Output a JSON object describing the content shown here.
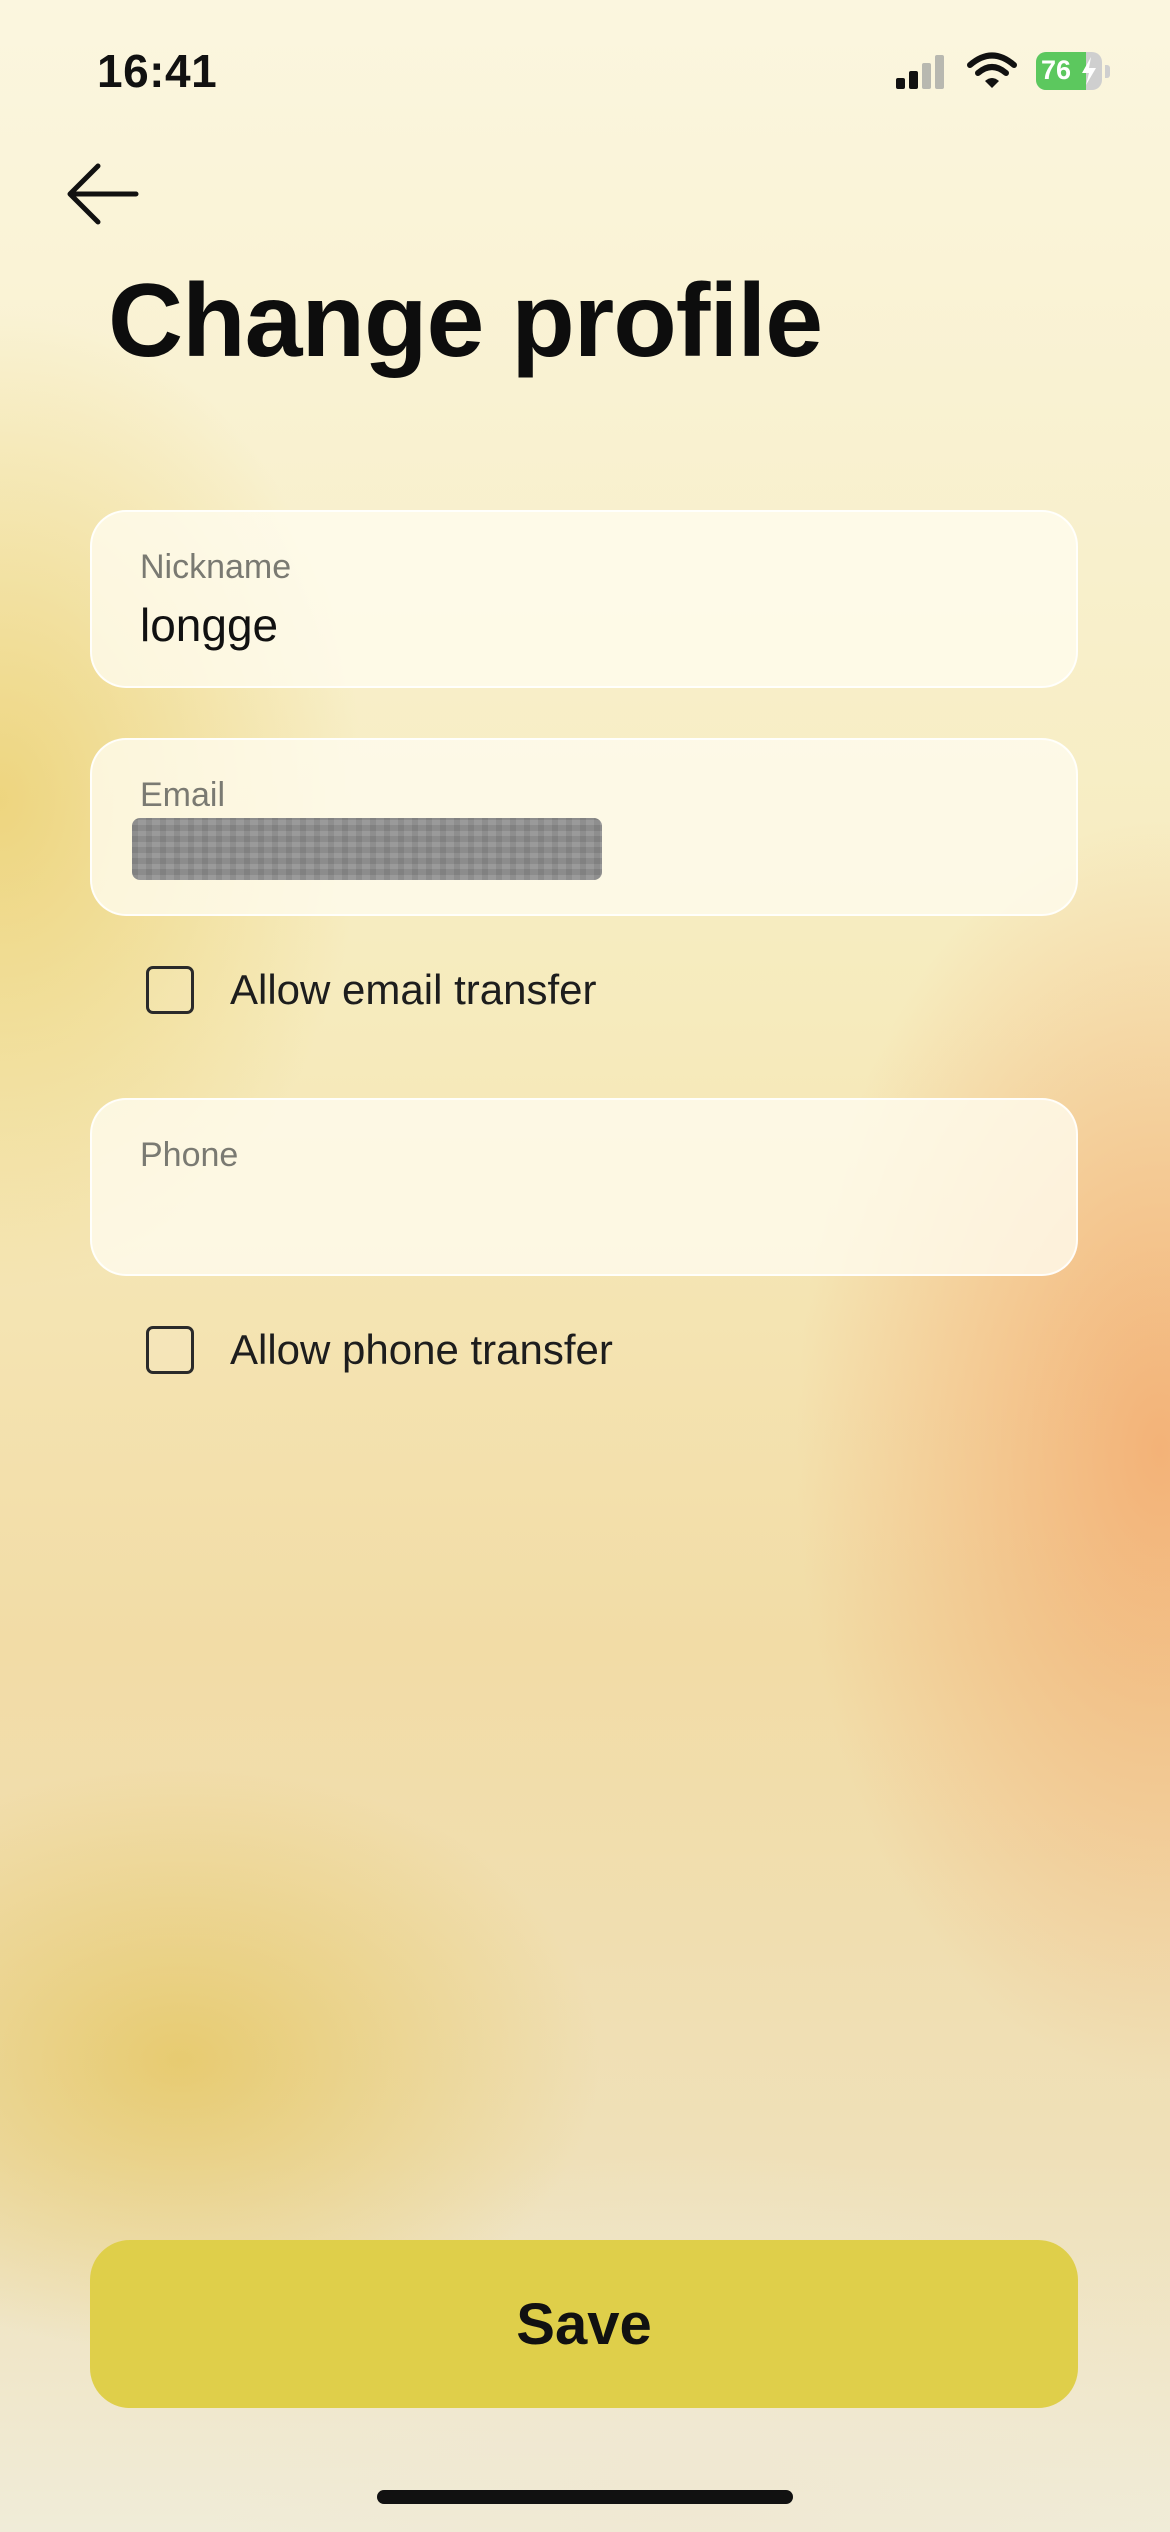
{
  "status_bar": {
    "time": "16:41",
    "battery_level": "76",
    "battery_fraction": 0.76,
    "signal_bars_active": 2,
    "signal_bars_total": 4,
    "icons": [
      "signal-icon",
      "wifi-icon",
      "battery-icon",
      "charging-bolt-icon"
    ]
  },
  "header": {
    "back_icon": "arrow-left-icon",
    "title": "Change profile"
  },
  "form": {
    "nickname": {
      "label": "Nickname",
      "value": "longge"
    },
    "email": {
      "label": "Email",
      "redacted": true
    },
    "email_transfer": {
      "label": "Allow email transfer",
      "checked": false
    },
    "phone": {
      "label": "Phone",
      "value": ""
    },
    "phone_transfer": {
      "label": "Allow phone transfer",
      "checked": false
    }
  },
  "actions": {
    "save_label": "Save"
  },
  "colors": {
    "save_button": "#dfcf4a",
    "battery_green": "#5cc85e",
    "background_light": "#fbf6df",
    "background_orange": "#f3aa6e"
  }
}
